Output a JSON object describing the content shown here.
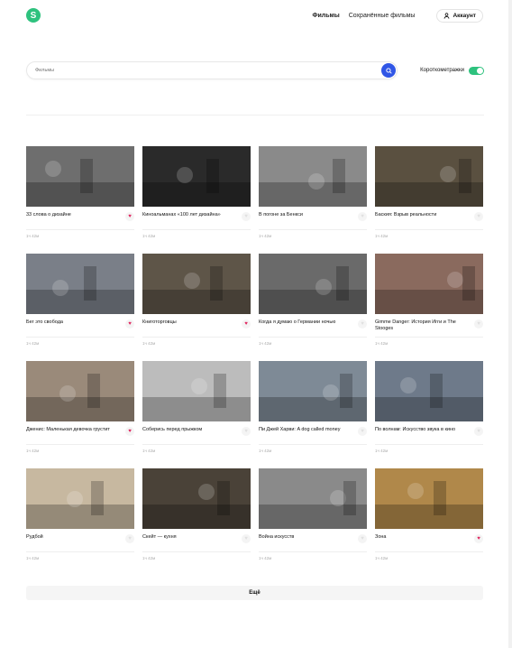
{
  "brand": {
    "logo_letter": "S",
    "color": "#2ec27e"
  },
  "nav": {
    "films": "Фильмы",
    "saved": "Сохранённые фильмы",
    "account": "Аккаунт"
  },
  "search": {
    "placeholder": "Фильмы",
    "shorts_label": "Короткометражки",
    "shorts_on": true
  },
  "films": [
    {
      "title": "33 слова о дизайне",
      "duration": "1ч 42м",
      "favorite": true,
      "icon": "film-still"
    },
    {
      "title": "Киноальманах «100 лет дизайна»",
      "duration": "1ч 42м",
      "favorite": false,
      "icon": "film-still"
    },
    {
      "title": "В погоне за Бенкси",
      "duration": "1ч 42м",
      "favorite": false,
      "icon": "film-still"
    },
    {
      "title": "Баския: Взрыв реальности",
      "duration": "1ч 42м",
      "favorite": false,
      "icon": "film-still"
    },
    {
      "title": "Бег это свобода",
      "duration": "1ч 42м",
      "favorite": true,
      "icon": "film-still"
    },
    {
      "title": "Книготорговцы",
      "duration": "1ч 42м",
      "favorite": true,
      "icon": "film-still"
    },
    {
      "title": "Когда я думаю о Германии ночью",
      "duration": "1ч 42м",
      "favorite": false,
      "icon": "film-still"
    },
    {
      "title": "Gimme Danger: История Игги и The Stooges",
      "duration": "1ч 42м",
      "favorite": false,
      "icon": "film-still"
    },
    {
      "title": "Дженис: Маленькая девочка грустит",
      "duration": "1ч 42м",
      "favorite": true,
      "icon": "film-still"
    },
    {
      "title": "Соберись перед прыжком",
      "duration": "1ч 42м",
      "favorite": false,
      "icon": "film-still"
    },
    {
      "title": "Пи Джей Харви: A dog called money",
      "duration": "1ч 42м",
      "favorite": false,
      "icon": "film-still"
    },
    {
      "title": "По волнам: Искусство звука в кино",
      "duration": "1ч 42м",
      "favorite": false,
      "icon": "film-still"
    },
    {
      "title": "Рудбой",
      "duration": "1ч 42м",
      "favorite": false,
      "icon": "film-still"
    },
    {
      "title": "Скейт — кухня",
      "duration": "1ч 42м",
      "favorite": false,
      "icon": "film-still"
    },
    {
      "title": "Война искусств",
      "duration": "1ч 42м",
      "favorite": false,
      "icon": "film-still"
    },
    {
      "title": "Зона",
      "duration": "1ч 42м",
      "favorite": true,
      "icon": "film-still"
    }
  ],
  "thumb_colors": [
    "#6e6e6e",
    "#2a2a2a",
    "#8a8a8a",
    "#5a5040",
    "#7a7f88",
    "#5e5548",
    "#6a6a6a",
    "#8a6a5e",
    "#9a8a7a",
    "#bcbcbc",
    "#7e8a96",
    "#6e7a8a",
    "#c7b8a0",
    "#4a4238",
    "#8a8a8a",
    "#b0884a"
  ],
  "load_more": "Ещё"
}
